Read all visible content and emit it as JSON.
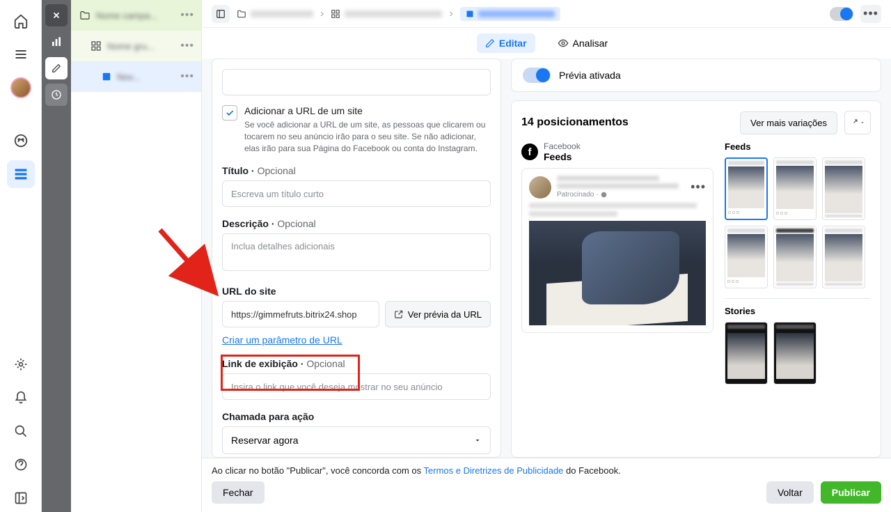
{
  "tree": {
    "lvl1": "Nome campa...",
    "lvl2": "Nome gru...",
    "lvl3": "Nov..."
  },
  "crumb": {
    "c1": "Nome campanha",
    "c2": "Nome grupo de anuncios",
    "c3": "Nome do anuncio"
  },
  "tabs": {
    "edit": "Editar",
    "analyze": "Analisar"
  },
  "form": {
    "add_url_label": "Adicionar a URL de um site",
    "add_url_desc": "Se você adicionar a URL de um site, as pessoas que clicarem ou tocarem no seu anúncio irão para o seu site. Se não adicionar, elas irão para sua Página do Facebook ou conta do Instagram.",
    "title_label": "Título",
    "optional": "Opcional",
    "title_placeholder": "Escreva um título curto",
    "desc_label": "Descrição",
    "desc_placeholder": "Inclua detalhes adicionais",
    "url_label": "URL do site",
    "url_value": "https://gimmefruts.bitrix24.shop",
    "preview_url": "Ver prévia da URL",
    "create_param": "Criar um parâmetro de URL",
    "display_link_label": "Link de exibição",
    "display_link_placeholder": "Insira o link que você deseja mostrar no seu anúncio",
    "cta_label": "Chamada para ação",
    "cta_value": "Reservar agora"
  },
  "preview": {
    "toggle_label": "Prévia ativada",
    "placements_count": "14 posicionamentos",
    "more_variations": "Ver mais variações",
    "network": "Facebook",
    "placement_type": "Feeds",
    "sponsored": "Patrocinado",
    "feeds_label": "Feeds",
    "stories_label": "Stories"
  },
  "footer": {
    "disclaimer_pre": "Ao clicar no botão \"Publicar\", você concorda com os ",
    "disclaimer_link": "Termos e Diretrizes de Publicidade",
    "disclaimer_post": " do Facebook.",
    "close": "Fechar",
    "back": "Voltar",
    "publish": "Publicar"
  }
}
